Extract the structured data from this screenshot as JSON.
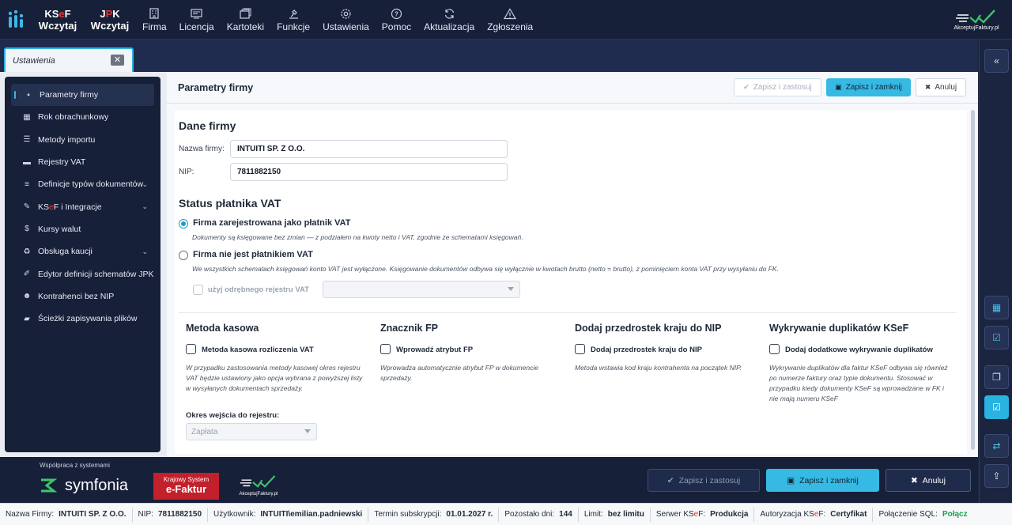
{
  "topbar": {
    "ksef": {
      "part1": "KS",
      "part2": "e",
      "part3": "F",
      "line2": "Wczytaj"
    },
    "jpk": {
      "part1": "J",
      "part2": "P",
      "part3": "K",
      "line2": "Wczytaj"
    },
    "items": [
      {
        "label": "Firma",
        "icon": "building-icon"
      },
      {
        "label": "Licencja",
        "icon": "license-icon"
      },
      {
        "label": "Kartoteki",
        "icon": "folders-icon"
      },
      {
        "label": "Funkcje",
        "icon": "functions-icon"
      },
      {
        "label": "Ustawienia",
        "icon": "gear-icon"
      },
      {
        "label": "Pomoc",
        "icon": "help-icon"
      },
      {
        "label": "Aktualizacja",
        "icon": "refresh-icon"
      },
      {
        "label": "Zgłoszenia",
        "icon": "warning-icon"
      }
    ],
    "brand": "AkceptujFaktury.pl"
  },
  "tab": {
    "label": "Ustawienia",
    "close": "✕"
  },
  "sidebar": {
    "items": [
      {
        "label": "Parametry firmy",
        "icon": "document-icon",
        "active": true
      },
      {
        "label": "Rok obrachunkowy",
        "icon": "calendar-icon"
      },
      {
        "label": "Metody importu",
        "icon": "sliders-icon"
      },
      {
        "label": "Rejestry VAT",
        "icon": "register-icon"
      },
      {
        "label": "Definicje typów dokumentów",
        "icon": "list-icon",
        "chevron": true
      },
      {
        "label_a": "KS",
        "label_b": "e",
        "label_c": "F i Integracje",
        "icon": "tools-icon",
        "chevron": true
      },
      {
        "label": "Kursy walut",
        "icon": "dollar-icon"
      },
      {
        "label": "Obsługa kaucji",
        "icon": "recycle-icon",
        "chevron": true
      },
      {
        "label": "Edytor definicji schematów JPK",
        "icon": "edit-icon"
      },
      {
        "label": "Kontrahenci bez NIP",
        "icon": "users-icon"
      },
      {
        "label": "Ścieżki zapisywania plików",
        "icon": "folder-icon"
      }
    ]
  },
  "main": {
    "title": "Parametry firmy",
    "buttons": {
      "apply": "Zapisz i zastosuj",
      "save_close": "Zapisz i zamknij",
      "cancel": "Anuluj"
    },
    "dane": {
      "title": "Dane firmy",
      "name_label": "Nazwa firmy:",
      "name_value": "INTUITI SP. Z O.O.",
      "nip_label": "NIP:",
      "nip_value": "7811882150"
    },
    "vat": {
      "title": "Status płatnika VAT",
      "opt1": "Firma zarejestrowana jako płatnik VAT",
      "opt1_desc": "Dokumenty są księgowane bez zmian — z podziałem na kwoty netto i VAT, zgodnie ze schematami księgowań.",
      "opt2": "Firma nie jest płatnikiem VAT",
      "opt2_desc": "We wszystkich schematach księgowań konto VAT jest wyłączone. Księgowanie dokumentów odbywa się wyłącznie w kwotach brutto (netto = brutto), z pominięciem konta VAT przy wysyłaniu do FK.",
      "separate_reg": "użyj odrębnego rejestru VAT",
      "selected": "opt1"
    },
    "kasowa": {
      "title": "Metoda kasowa",
      "checkbox": "Metoda kasowa rozliczenia VAT",
      "desc": "W przypadku zastosowania metody kasowej okres rejestru VAT będzie ustawiony jako opcja wybrana z powyższej listy w wysyłanych dokumentach sprzedaży.",
      "period_label": "Okres wejścia do rejestru:",
      "period_value": "Zapłata"
    },
    "fp": {
      "title": "Znacznik FP",
      "checkbox": "Wprowadź atrybut FP",
      "desc": "Wprowadza automatycznie atrybut FP w dokumencie sprzedaży."
    },
    "prefix": {
      "title": "Dodaj przedrostek kraju do NIP",
      "checkbox": "Dodaj przedrostek kraju do NIP",
      "desc": "Metoda wstawia kod kraju kontrahenta na początek NIP."
    },
    "dup": {
      "title": "Wykrywanie duplikatów KSeF",
      "checkbox": "Dodaj dodatkowe wykrywanie duplikatów",
      "desc": "Wykrywanie duplikatów dla faktur KSeF odbywa się również po numerze faktury oraz typie dokumentu. Stosować w przypadku kiedy dokumenty KSeF są wprowadzane w FK i nie mają numeru KSeF"
    }
  },
  "rail": {
    "collapse": "«"
  },
  "footer": {
    "coop": "Współpraca z systemami",
    "symfonia": "symfonia",
    "ksef_a": "Krajowy System",
    "ksef_b": "e-Faktur",
    "akc": "AkceptujFaktury.pl",
    "apply": "Zapisz i zastosuj",
    "save_close": "Zapisz i zamknij",
    "cancel": "Anuluj"
  },
  "status": {
    "firm_label": "Nazwa Firmy:",
    "firm": "INTUITI SP. Z O.O.",
    "nip_label": "NIP:",
    "nip": "7811882150",
    "user_label": "Użytkownik:",
    "user": "INTUITI\\emilian.padniewski",
    "term_label": "Termin subskrypcji:",
    "term": "01.01.2027 r.",
    "days_label": "Pozostało dni:",
    "days": "144",
    "limit_label": "Limit:",
    "limit": "bez limitu",
    "server_label_a": "Serwer KS",
    "server_label_b": "e",
    "server_label_c": "F:",
    "server": "Produkcja",
    "auth_label_a": "Autoryzacja KS",
    "auth_label_b": "e",
    "auth_label_c": "F:",
    "auth": "Certyfikat",
    "sql_label": "Połączenie SQL:",
    "sql": "Połącz"
  },
  "colors": {
    "accent": "#36b9e3",
    "topbar": "#172039",
    "ksef_red": "#e3342f"
  }
}
